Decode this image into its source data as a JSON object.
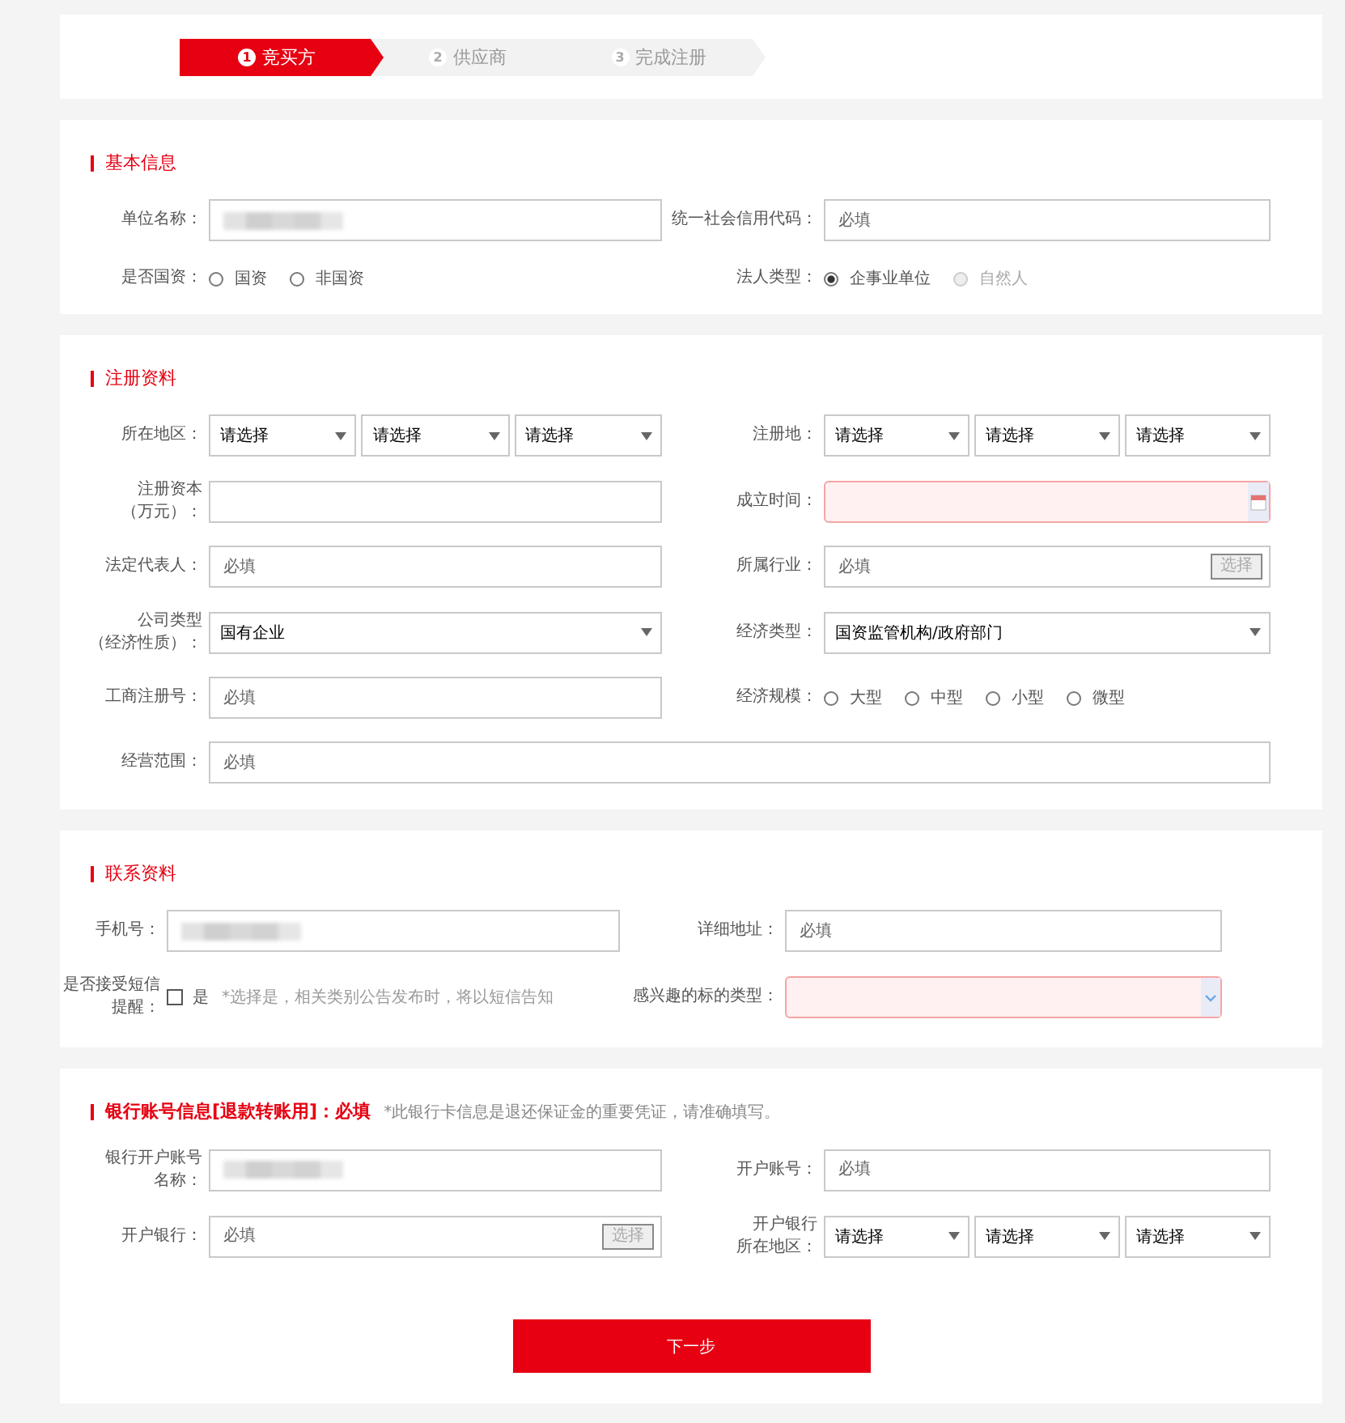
{
  "steps": [
    {
      "number": "1",
      "label": "竞买方",
      "selected": true
    },
    {
      "number": "2",
      "label": "供应商",
      "selected": false
    },
    {
      "number": "3",
      "label": "完成注册",
      "selected": false
    }
  ],
  "sections": [
    {
      "title": "基本信息",
      "bold": false,
      "rows": [
        [
          {
            "label": [
              "单位名称："
            ],
            "kind": "text",
            "value_hidden": true
          },
          {
            "label": [
              "统一社会信用代码："
            ],
            "kind": "text",
            "placeholder": "必填"
          }
        ],
        [
          {
            "label": [
              "是否国资："
            ],
            "kind": "radio",
            "options": [
              {
                "label": "国资",
                "selected": false,
                "disabled": false
              },
              {
                "label": "非国资",
                "selected": false,
                "disabled": false
              }
            ]
          },
          {
            "label": [
              "法人类型："
            ],
            "kind": "radio",
            "options": [
              {
                "label": "企事业单位",
                "selected": true,
                "disabled": false
              },
              {
                "label": "自然人",
                "selected": false,
                "disabled": true
              }
            ]
          }
        ]
      ]
    },
    {
      "title": "注册资料",
      "bold": false,
      "rows": [
        [
          {
            "label": [
              "所在地区："
            ],
            "kind": "selects",
            "values": [
              "请选择",
              "请选择",
              "请选择"
            ]
          },
          {
            "label": [
              "注册地："
            ],
            "kind": "selects",
            "values": [
              "请选择",
              "请选择",
              "请选择"
            ]
          }
        ],
        [
          {
            "label": [
              "注册资本",
              "（万元）："
            ],
            "kind": "text"
          },
          {
            "label": [
              "成立时间："
            ],
            "kind": "date",
            "invalid": true
          }
        ],
        [
          {
            "label": [
              "法定代表人："
            ],
            "kind": "text",
            "placeholder": "必填"
          },
          {
            "label": [
              "所属行业："
            ],
            "kind": "picker",
            "placeholder": "必填",
            "button": "选择"
          }
        ],
        [
          {
            "label": [
              "公司类型",
              "（经济性质）："
            ],
            "kind": "select",
            "value": "国有企业"
          },
          {
            "label": [
              "经济类型："
            ],
            "kind": "select",
            "value": "国资监管机构/政府部门"
          }
        ],
        [
          {
            "label": [
              "工商注册号："
            ],
            "kind": "text",
            "placeholder": "必填"
          },
          {
            "label": [
              "经济规模："
            ],
            "kind": "radio",
            "options": [
              {
                "label": "大型",
                "selected": false,
                "disabled": false
              },
              {
                "label": "中型",
                "selected": false,
                "disabled": false
              },
              {
                "label": "小型",
                "selected": false,
                "disabled": false
              },
              {
                "label": "微型",
                "selected": false,
                "disabled": false
              }
            ]
          }
        ],
        [
          {
            "label": [
              "经营范围："
            ],
            "kind": "text",
            "placeholder": "必填",
            "wide": true
          }
        ]
      ]
    },
    {
      "title": "联系资料",
      "bold": false,
      "rows": [
        [
          {
            "label": [
              "手机号："
            ],
            "kind": "text",
            "value_hidden": true
          },
          {
            "label": [
              "详细地址："
            ],
            "kind": "text",
            "placeholder": "必填"
          }
        ],
        [
          {
            "label": [
              "是否接受短信",
              "提醒："
            ],
            "kind": "checkbox",
            "option": "是",
            "checked": false,
            "note": "*选择是，相关类别公告发布时，将以短信告知"
          },
          {
            "label": [
              "感兴趣的标的类型："
            ],
            "kind": "dropdown",
            "invalid": true
          }
        ]
      ]
    },
    {
      "title": "银行账号信息[退款转账用]：必填",
      "bold": true,
      "note": "*此银行卡信息是退还保证金的重要凭证，请准确填写。",
      "rows": [
        [
          {
            "label": [
              "银行开户账号",
              "名称："
            ],
            "kind": "text",
            "value_hidden": true
          },
          {
            "label": [
              "开户账号："
            ],
            "kind": "text",
            "placeholder": "必填"
          }
        ],
        [
          {
            "label": [
              "开户银行："
            ],
            "kind": "picker",
            "placeholder": "必填",
            "button": "选择"
          },
          {
            "label": [
              "开户银行",
              "所在地区："
            ],
            "kind": "selects",
            "values": [
              "请选择",
              "请选择",
              "请选择"
            ]
          }
        ]
      ],
      "button": "下一步"
    }
  ]
}
